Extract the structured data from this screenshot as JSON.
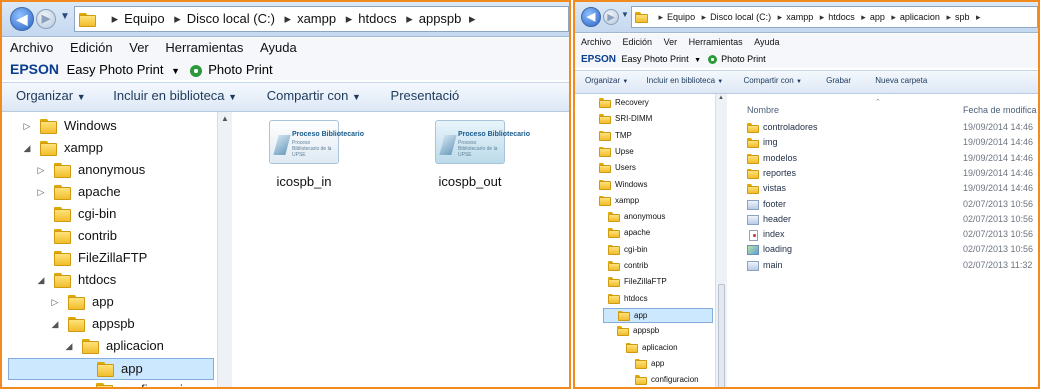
{
  "left": {
    "breadcrumb": [
      "Equipo",
      "Disco local (C:)",
      "xampp",
      "htdocs",
      "appspb"
    ],
    "menu": [
      "Archivo",
      "Edición",
      "Ver",
      "Herramientas",
      "Ayuda"
    ],
    "epson": {
      "logo": "EPSON",
      "easy_print": "Easy Photo Print",
      "photo_print": "Photo Print"
    },
    "toolbar": [
      "Organizar",
      "Incluir en biblioteca",
      "Compartir con",
      "Presentació"
    ],
    "tree": [
      {
        "label": "Windows",
        "arrow": "▷",
        "level": 0
      },
      {
        "label": "xampp",
        "arrow": "◢",
        "level": 0
      },
      {
        "label": "anonymous",
        "arrow": "▷",
        "level": 1
      },
      {
        "label": "apache",
        "arrow": "▷",
        "level": 1
      },
      {
        "label": "cgi-bin",
        "arrow": "",
        "level": 1
      },
      {
        "label": "contrib",
        "arrow": "",
        "level": 1
      },
      {
        "label": "FileZillaFTP",
        "arrow": "",
        "level": 1
      },
      {
        "label": "htdocs",
        "arrow": "◢",
        "level": 1
      },
      {
        "label": "app",
        "arrow": "▷",
        "level": 2
      },
      {
        "label": "appspb",
        "arrow": "◢",
        "level": 2
      },
      {
        "label": "aplicacion",
        "arrow": "◢",
        "level": 3
      },
      {
        "label": "app",
        "arrow": "",
        "level": 4,
        "selected": true
      },
      {
        "label": "configuracion",
        "arrow": "",
        "level": 4
      }
    ],
    "tiles": [
      {
        "label": "icospb_in",
        "thumb_title": "Proceso Bibliotecario",
        "thumb_sub": "Proceso Bibliotecario de la UPSE"
      },
      {
        "label": "icospb_out",
        "thumb_title": "Proceso Bibliotecario",
        "thumb_sub": "Proceso Bibliotecario de la UPSE"
      }
    ]
  },
  "right": {
    "breadcrumb": [
      "Equipo",
      "Disco local (C:)",
      "xampp",
      "htdocs",
      "app",
      "aplicacion",
      "spb"
    ],
    "menu": [
      "Archivo",
      "Edición",
      "Ver",
      "Herramientas",
      "Ayuda"
    ],
    "epson": {
      "logo": "EPSON",
      "easy_print": "Easy Photo Print",
      "photo_print": "Photo Print"
    },
    "toolbar": [
      "Organizar",
      "Incluir en biblioteca",
      "Compartir con",
      "Grabar",
      "Nueva carpeta"
    ],
    "tree": [
      {
        "label": "Recovery",
        "level": 0
      },
      {
        "label": "SRI-DIMM",
        "level": 0
      },
      {
        "label": "TMP",
        "level": 0
      },
      {
        "label": "Upse",
        "level": 0
      },
      {
        "label": "Users",
        "level": 0
      },
      {
        "label": "Windows",
        "level": 0
      },
      {
        "label": "xampp",
        "level": 0
      },
      {
        "label": "anonymous",
        "level": 1
      },
      {
        "label": "apache",
        "level": 1
      },
      {
        "label": "cgi-bin",
        "level": 1
      },
      {
        "label": "contrib",
        "level": 1
      },
      {
        "label": "FileZillaFTP",
        "level": 1
      },
      {
        "label": "htdocs",
        "level": 1
      },
      {
        "label": "app",
        "level": 2,
        "selected": true
      },
      {
        "label": "appspb",
        "level": 2
      },
      {
        "label": "aplicacion",
        "level": 3
      },
      {
        "label": "app",
        "level": 4
      },
      {
        "label": "configuracion",
        "level": 4
      }
    ],
    "columns": {
      "name": "Nombre",
      "date": "Fecha de modifica"
    },
    "files": [
      {
        "name": "controladores",
        "date": "19/09/2014 14:46",
        "kind": "folder"
      },
      {
        "name": "img",
        "date": "19/09/2014 14:46",
        "kind": "folder"
      },
      {
        "name": "modelos",
        "date": "19/09/2014 14:46",
        "kind": "folder"
      },
      {
        "name": "reportes",
        "date": "19/09/2014 14:46",
        "kind": "folder"
      },
      {
        "name": "vistas",
        "date": "19/09/2014 14:46",
        "kind": "folder"
      },
      {
        "name": "footer",
        "date": "02/07/2013 10:56",
        "kind": "file"
      },
      {
        "name": "header",
        "date": "02/07/2013 10:56",
        "kind": "file"
      },
      {
        "name": "index",
        "date": "02/07/2013 10:56",
        "kind": "page"
      },
      {
        "name": "loading",
        "date": "02/07/2013 10:56",
        "kind": "image"
      },
      {
        "name": "main",
        "date": "02/07/2013 11:32",
        "kind": "file"
      }
    ]
  }
}
